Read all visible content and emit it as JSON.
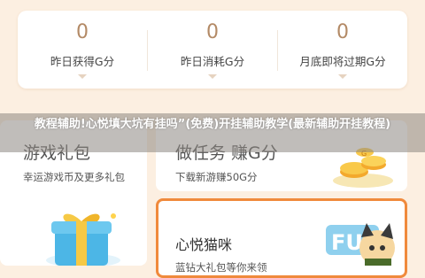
{
  "stats": [
    {
      "value": "0",
      "label": "昨日获得G分"
    },
    {
      "value": "0",
      "label": "昨日消耗G分"
    },
    {
      "value": "0",
      "label": "月底即将过期G分"
    }
  ],
  "cards": {
    "games_gift": {
      "title": "游戏礼包",
      "subtitle": "幸运游戏币及更多礼包"
    },
    "earn_points": {
      "title": "做任务 赚G分",
      "subtitle": "下载新游赚50G分"
    },
    "cat": {
      "title": "心悦猫咪",
      "subtitle": "蓝钻大礼包等你来领"
    }
  },
  "overlay": {
    "text": "教程辅助!心悦填大坑有挂吗”(免费)开挂辅助教学(最新辅助开挂教程)"
  },
  "colors": {
    "background": "#fcefe1",
    "card": "#ffffff",
    "stat_value": "#b38a66",
    "highlight_border": "#f08a3c"
  },
  "icons": [
    "gift-box-icon",
    "coins-icon",
    "cat-mascot-icon"
  ]
}
